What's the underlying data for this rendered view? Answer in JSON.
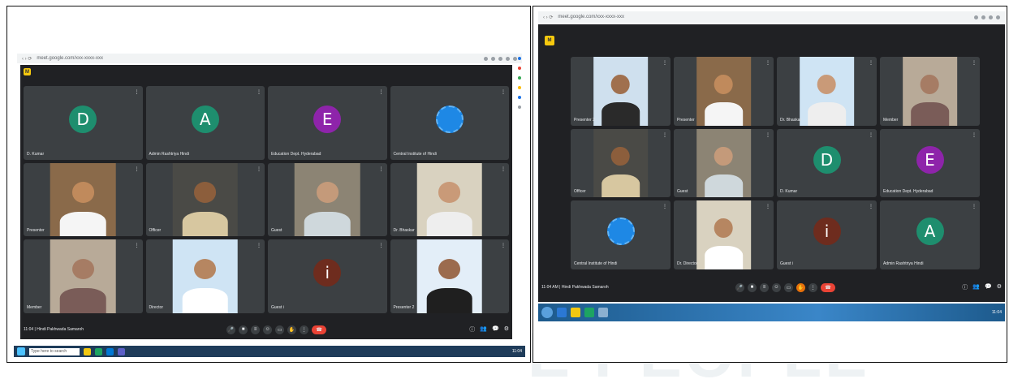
{
  "left": {
    "address": {
      "url": "meet.google.com/xxx-xxxx-xxx"
    },
    "tiles": [
      {
        "kind": "avatar",
        "letter": "D",
        "color": "#1e8e6e",
        "name": "D. Kumar"
      },
      {
        "kind": "avatar",
        "letter": "A",
        "color": "#1e8e6e",
        "name": "Admin Rashtriya Hindi"
      },
      {
        "kind": "avatar",
        "letter": "E",
        "color": "#8e24aa",
        "name": "Education Dept. Hyderabad"
      },
      {
        "kind": "logo",
        "name": "Central Institute of Hindi"
      },
      {
        "kind": "video",
        "skin": "#c08a5c",
        "shirt": "#f5f5f5",
        "bg": "#8a6a4a",
        "name": "Presenter"
      },
      {
        "kind": "video",
        "skin": "#8c5e3c",
        "shirt": "#d7c7a0",
        "bg": "#4a4a46",
        "name": "Officer"
      },
      {
        "kind": "video",
        "skin": "#c49a7a",
        "shirt": "#cfd8dc",
        "bg": "#8c8474",
        "name": "Guest"
      },
      {
        "kind": "video",
        "skin": "#c99a78",
        "shirt": "#eeeeee",
        "bg": "#d9d2c0",
        "name": "Dr. Bhaskar"
      },
      {
        "kind": "video",
        "skin": "#a67c64",
        "shirt": "#7a5c58",
        "bg": "#b8aa98",
        "name": "Member"
      },
      {
        "kind": "video",
        "skin": "#b68661",
        "shirt": "#ffffff",
        "bg": "#cfe4f4",
        "name": "Director"
      },
      {
        "kind": "avatar",
        "letter": "i",
        "color": "#6e2c1e",
        "name": "Guest i"
      },
      {
        "kind": "video",
        "skin": "#9b6b4e",
        "shirt": "#1f1f1f",
        "bg": "#e3eef8",
        "name": "Presenter 2"
      }
    ],
    "controls": {
      "info": "11:04 | Hindi Pakhwada Samaroh",
      "buttons": [
        "mic",
        "cam",
        "cc",
        "emoji",
        "present",
        "hand",
        "more",
        "end"
      ],
      "right": [
        "ⓘ",
        "👥",
        "💬",
        "⚙"
      ]
    },
    "taskbar": {
      "search": "Type here to search",
      "tray": "11:04"
    }
  },
  "right": {
    "address": {
      "url": "meet.google.com/xxx-xxxx-xxx"
    },
    "tiles": [
      {
        "kind": "video",
        "skin": "#a0704e",
        "shirt": "#2a2a2a",
        "bg": "#cfe0ee",
        "name": "Presenter 2"
      },
      {
        "kind": "video",
        "skin": "#c08a5c",
        "shirt": "#f5f5f5",
        "bg": "#8a6a4a",
        "name": "Presenter"
      },
      {
        "kind": "video",
        "skin": "#c99a78",
        "shirt": "#eeeeee",
        "bg": "#cfe4f4",
        "name": "Dr. Bhaskar"
      },
      {
        "kind": "video",
        "skin": "#a67c64",
        "shirt": "#7a5c58",
        "bg": "#b8aa98",
        "name": "Member"
      },
      {
        "kind": "video",
        "skin": "#8c5e3c",
        "shirt": "#d7c7a0",
        "bg": "#4a4a46",
        "name": "Officer"
      },
      {
        "kind": "video",
        "skin": "#c49a7a",
        "shirt": "#cfd8dc",
        "bg": "#8c8474",
        "name": "Guest"
      },
      {
        "kind": "avatar",
        "letter": "D",
        "color": "#1e8e6e",
        "name": "D. Kumar"
      },
      {
        "kind": "avatar",
        "letter": "E",
        "color": "#8e24aa",
        "name": "Education Dept. Hyderabad"
      },
      {
        "kind": "logo",
        "name": "Central Institute of Hindi"
      },
      {
        "kind": "video",
        "skin": "#b68661",
        "shirt": "#ffffff",
        "bg": "#d9d2c0",
        "name": "Dr. Director"
      },
      {
        "kind": "avatar",
        "letter": "i",
        "color": "#6e2c1e",
        "name": "Guest i"
      },
      {
        "kind": "avatar",
        "letter": "A",
        "color": "#1e8e6e",
        "name": "Admin Rashtriya Hindi"
      }
    ],
    "controls": {
      "info": "11:04 AM | Hindi Pakhwada Samaroh",
      "buttons": [
        "mic",
        "cam",
        "cc",
        "emoji",
        "present",
        "hand",
        "more",
        "end"
      ],
      "right": [
        "ⓘ",
        "👥",
        "💬",
        "⚙"
      ]
    },
    "taskbar": {
      "tray": "11:04"
    }
  },
  "watermark": "E PEOPLE"
}
